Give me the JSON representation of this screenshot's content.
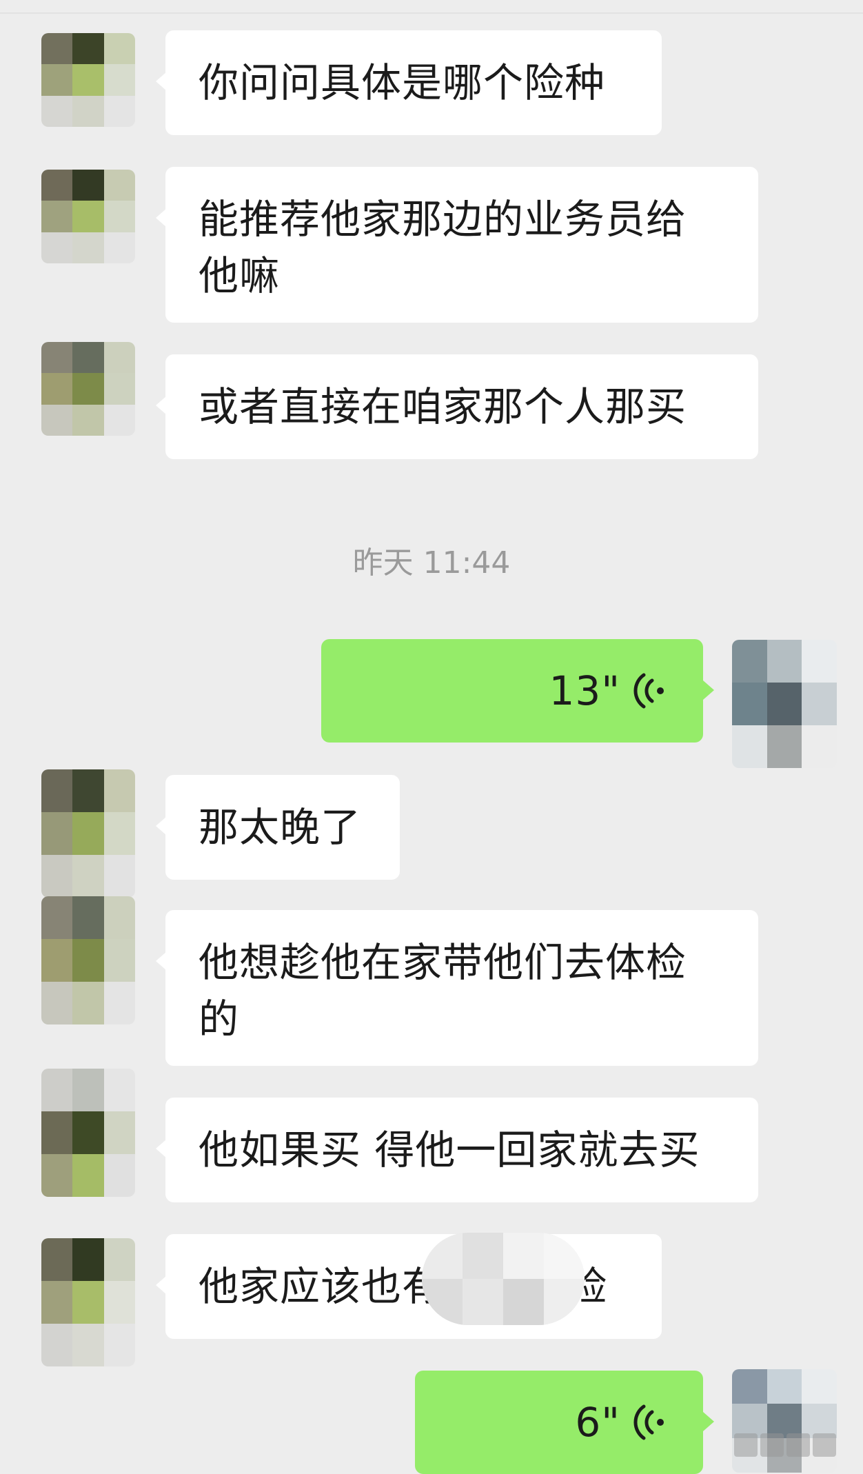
{
  "messages": [
    {
      "side": "left",
      "text": "你问问具体是哪个险种"
    },
    {
      "side": "left",
      "text": "能推荐他家那边的业务员给他嘛"
    },
    {
      "side": "left",
      "text": "或者直接在咱家那个人那买"
    },
    {
      "side": "left",
      "text": "那太晚了"
    },
    {
      "side": "left",
      "text": "他想趁他在家带他们去体检的"
    },
    {
      "side": "left",
      "text": "他如果买 得他一回家就去买"
    },
    {
      "side": "left",
      "text": "他家应该也有",
      "text_end": "险"
    }
  ],
  "timestamp": "昨天 11:44",
  "voice_messages": [
    {
      "duration": "13\"",
      "icon": "voice-wave-icon"
    },
    {
      "duration": "6\"",
      "icon": "voice-wave-icon"
    }
  ],
  "colors": {
    "background": "#ededed",
    "incoming_bubble": "#ffffff",
    "outgoing_bubble": "#95ec69",
    "timestamp_text": "#9a9a9a"
  }
}
